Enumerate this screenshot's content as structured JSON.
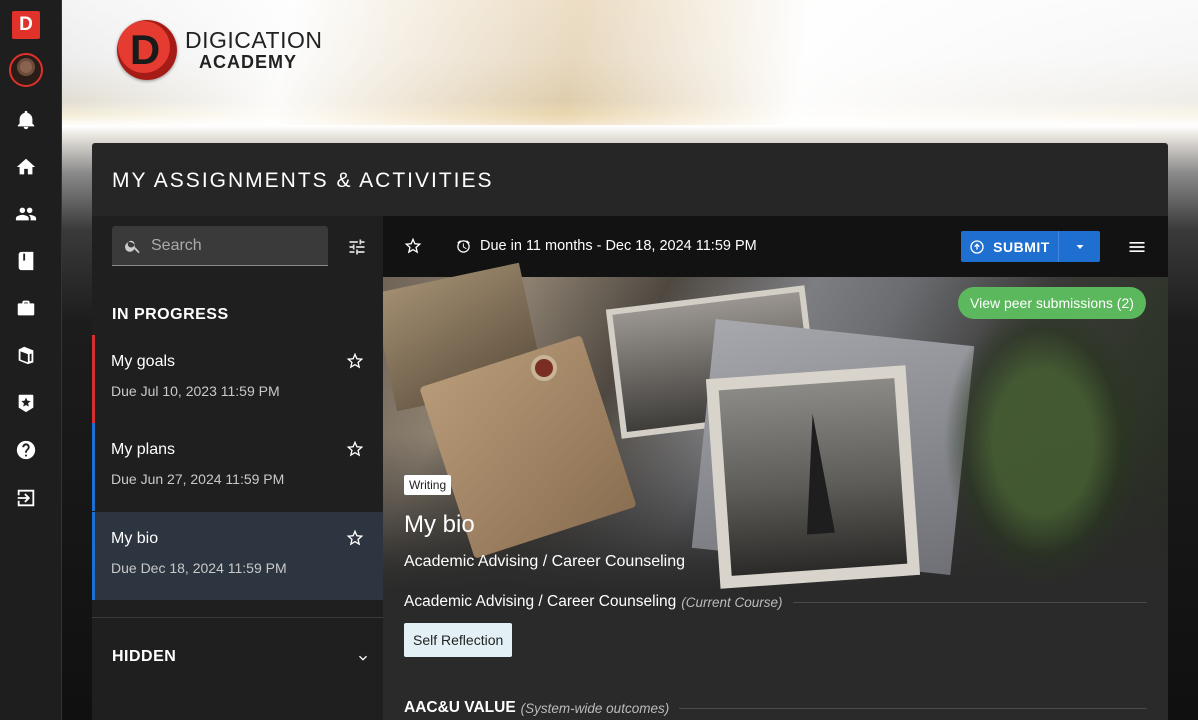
{
  "rail": {
    "logo_letter": "D",
    "icons": [
      "bell-icon",
      "home-icon",
      "people-icon",
      "book-icon",
      "briefcase-icon",
      "books-icon",
      "star-badge-icon",
      "help-icon",
      "logout-icon"
    ]
  },
  "brand": {
    "mark_letter": "D",
    "line1": "DIGICATION",
    "line2": "ACADEMY",
    "accent": "#e0312a"
  },
  "page": {
    "title": "MY ASSIGNMENTS & ACTIVITIES"
  },
  "search": {
    "placeholder": "Search",
    "value": ""
  },
  "sections": {
    "in_progress": "IN PROGRESS",
    "hidden": "HIDDEN"
  },
  "items": [
    {
      "name": "My goals",
      "due": "Due Jul 10, 2023 11:59 PM",
      "accent": "#d32f2f"
    },
    {
      "name": "My plans",
      "due": "Due Jun 27, 2024 11:59 PM",
      "accent": "#1e6fd0"
    },
    {
      "name": "My bio",
      "due": "Due Dec 18, 2024 11:59 PM",
      "accent": "#1e6fd0"
    }
  ],
  "toolbar": {
    "due_text": "Due in 11 months - Dec 18, 2024 11:59 PM",
    "submit_label": "SUBMIT"
  },
  "hero": {
    "peer_label": "View peer submissions (2)",
    "tag": "Writing",
    "title": "My bio",
    "subtitle": "Academic Advising / Career Counseling"
  },
  "course": {
    "name": "Academic Advising / Career Counseling",
    "note": "(Current Course)",
    "chip": "Self Reflection"
  },
  "aac": {
    "name": "AAC&U VALUE",
    "note": "(System-wide outcomes)"
  },
  "colors": {
    "submit": "#1e6fd0",
    "peer": "#5cb85c"
  }
}
